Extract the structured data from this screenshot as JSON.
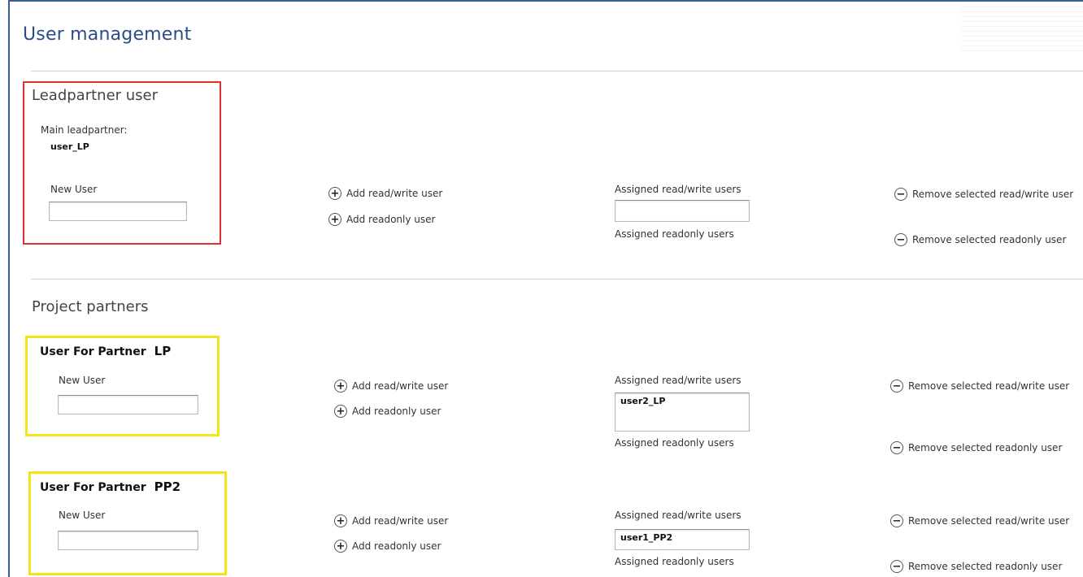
{
  "page": {
    "title": "User management"
  },
  "leadpartner": {
    "section_title": "Leadpartner user",
    "main_label": "Main leadpartner:",
    "main_user": "user_LP",
    "new_user_label": "New User",
    "new_user_value": "",
    "add_rw": "Add read/write user",
    "add_ro": "Add readonly user",
    "assigned_rw_label": "Assigned read/write users",
    "assigned_rw": [],
    "assigned_ro_label": "Assigned readonly users",
    "remove_rw": "Remove selected read/write user",
    "remove_ro": "Remove selected readonly user"
  },
  "project_partners": {
    "section_title": "Project partners",
    "partners": [
      {
        "heading": "User For Partner",
        "code": "LP",
        "new_user_label": "New User",
        "new_user_value": "",
        "add_rw": "Add read/write user",
        "add_ro": "Add readonly user",
        "assigned_rw_label": "Assigned read/write users",
        "assigned_rw": [
          "user2_LP"
        ],
        "assigned_ro_label": "Assigned readonly users",
        "remove_rw": "Remove selected read/write user",
        "remove_ro": "Remove selected readonly user"
      },
      {
        "heading": "User For Partner",
        "code": "PP2",
        "new_user_label": "New User",
        "new_user_value": "",
        "add_rw": "Add read/write user",
        "add_ro": "Add readonly user",
        "assigned_rw_label": "Assigned read/write users",
        "assigned_rw": [
          "user1_PP2"
        ],
        "assigned_ro_label": "Assigned readonly users",
        "remove_rw": "Remove selected read/write user",
        "remove_ro": "Remove selected readonly user"
      }
    ]
  },
  "icons": {
    "add": "plus-circle-icon",
    "remove": "minus-circle-icon"
  },
  "colors": {
    "title": "#2a4d8a",
    "highlight_red": "#e03030",
    "highlight_yellow": "#f4e514"
  }
}
